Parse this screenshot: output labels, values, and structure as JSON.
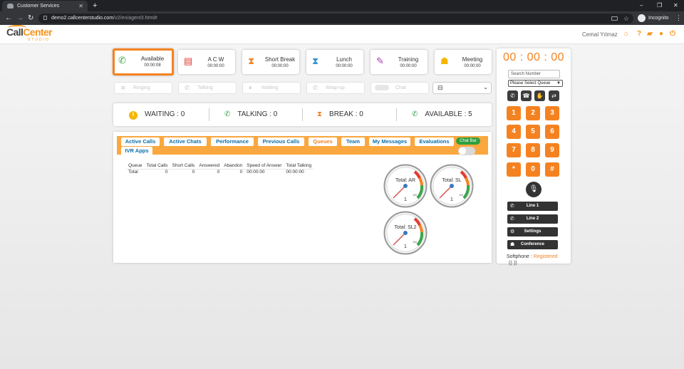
{
  "browser": {
    "tab_title": "Customer Services",
    "url_host": "demo2.callcenterstudio.com",
    "url_path": "/v2/en/agent3.html#",
    "incognito_label": "Incognito"
  },
  "header": {
    "logo_main_a": "Call",
    "logo_main_b": "Center",
    "logo_sub": "STUDIO",
    "user_name": "Cemal Yılmaz"
  },
  "status_cards": [
    {
      "name": "Available",
      "time": "00:00:08",
      "icon": "phone-icon",
      "color": "#3aa64a"
    },
    {
      "name": "A C W",
      "time": "00:00:00",
      "icon": "document-icon",
      "color": "#e2382f"
    },
    {
      "name": "Short Break",
      "time": "00:00:00",
      "icon": "hourglass-icon",
      "color": "#f58220"
    },
    {
      "name": "Lunch",
      "time": "00:00:00",
      "icon": "hourglass-icon",
      "color": "#2a8fd6"
    },
    {
      "name": "Training",
      "time": "00:00:00",
      "icon": "pencil-icon",
      "color": "#b03ab8"
    },
    {
      "name": "Meeting",
      "time": "00:00:00",
      "icon": "users-icon",
      "color": "#f5b600"
    }
  ],
  "call_actions": [
    "Ringing",
    "Talking",
    "Waiting",
    "Wrap-up",
    "Chat"
  ],
  "stats": [
    {
      "label": "WAITING : 0"
    },
    {
      "label": "TALKING : 0"
    },
    {
      "label": "BREAK : 0"
    },
    {
      "label": "AVAILABLE : 5"
    }
  ],
  "tabs": [
    "Active Calls",
    "Active Chats",
    "Performance",
    "Previous Calls",
    "Queues",
    "Team",
    "My Messages",
    "Evaluations",
    "IVR Apps"
  ],
  "selected_tab": "Queues",
  "chat_bar_label": "Chat Bar",
  "queue_table": {
    "headers": [
      "Queue",
      "Total Calls",
      "Short Calls",
      "Answered",
      "Abandon",
      "Speed of Answer",
      "Total Talking"
    ],
    "rows": [
      [
        "Total",
        "0",
        "0",
        "0",
        "0",
        "00:00:00",
        "00:00:00"
      ]
    ]
  },
  "gauges": [
    {
      "label": "Total: AR",
      "value": "1",
      "scale_max": "100"
    },
    {
      "label": "Total: SL",
      "value": "1",
      "scale_max": "100"
    },
    {
      "label": "Total: SL2",
      "value": "1",
      "scale_max": "100"
    }
  ],
  "softphone": {
    "timer": "00 : 00 : 00",
    "search_placeholder": "Search Number",
    "queue_select": "Please Select Queue",
    "keys": [
      "1",
      "2",
      "3",
      "4",
      "5",
      "6",
      "7",
      "8",
      "9",
      "*",
      "0",
      "#"
    ],
    "lines": [
      "Line 1",
      "Line 2",
      "Settings",
      "Conference"
    ],
    "status_label": "Softphone : ",
    "status_value": "Registered"
  },
  "colors": {
    "accent": "#f58220",
    "tab_bar": "#f9a73e",
    "link": "#0a6fa8",
    "chat_bar": "#2e9e3e"
  }
}
